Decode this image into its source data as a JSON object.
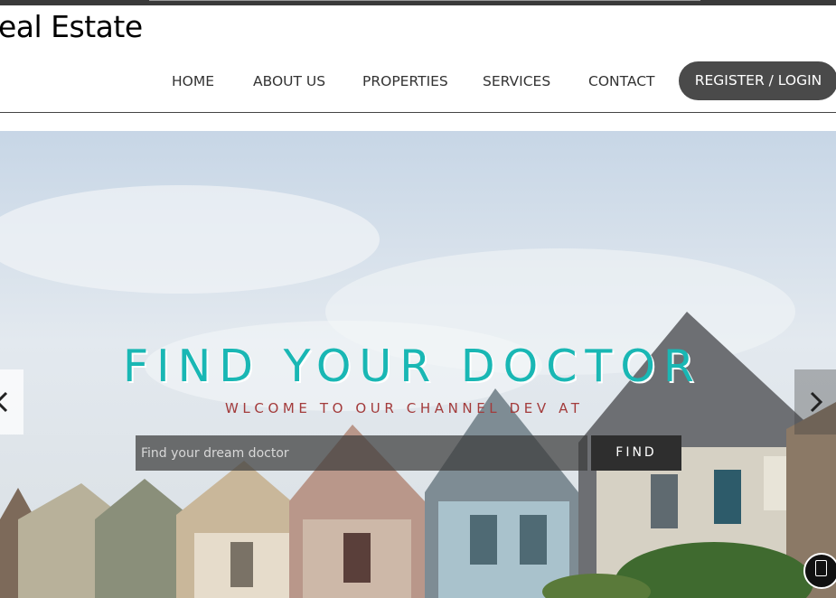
{
  "brand": {
    "title": "eal Estate"
  },
  "nav": {
    "items": [
      "HOME",
      "ABOUT US",
      "PROPERTIES",
      "SERVICES",
      "CONTACT"
    ],
    "register_label": "REGISTER / LOGIN"
  },
  "hero": {
    "title": "FIND YOUR DOCTOR",
    "subtitle": "WLCOME TO OUR CHANNEL DEV AT",
    "search_placeholder": "Find your dream doctor",
    "search_value": "",
    "find_label": "FIND"
  },
  "icons": {
    "prev": "chevron-left-icon",
    "next": "chevron-right-icon",
    "chat": "chat-icon"
  },
  "colors": {
    "accent": "#19b7b4",
    "subtitle": "#a33b3b",
    "register_bg": "#4a4a4a",
    "find_bg": "#2e2e2e"
  }
}
